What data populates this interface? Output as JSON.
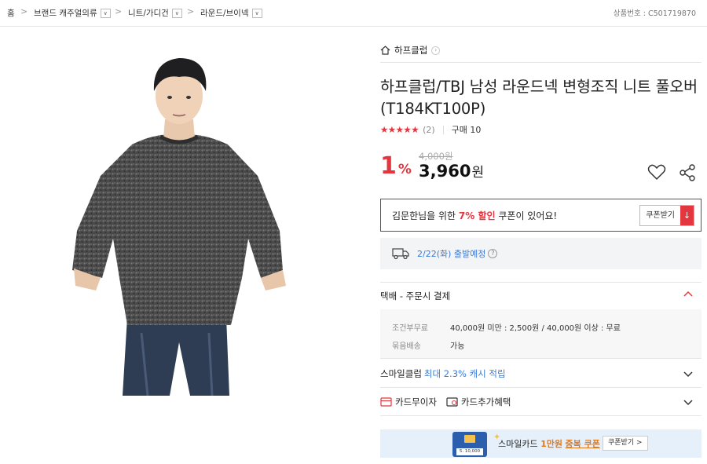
{
  "breadcrumb": {
    "home": "홈",
    "level1": "브랜드 캐주얼의류",
    "level2": "니트/가디건",
    "level3": "라운드/브이넥",
    "separator": ">",
    "dropdown_icon": "chevron-down-icon"
  },
  "product_number_label": "상품번호 : C501719870",
  "store": {
    "name": "하프클럽"
  },
  "product": {
    "title": "하프클럽/TBJ 남성 라운드넥 변형조직 니트 풀오버(T184KT100P)",
    "stars": "★★★★★",
    "review_count": "(2)",
    "purchase_count": "구매 10",
    "original_price": "4,000원",
    "discount_rate": "1",
    "discount_unit": "%",
    "sale_price": "3,960",
    "currency": "원"
  },
  "coupon": {
    "text_before": "김문한님을 위한 ",
    "highlight": "7% 할인",
    "text_after": " 쿠폰이 있어요!",
    "button_label": "쿠폰받기",
    "download_icon": "↓"
  },
  "shipping": {
    "date": "2/22(화) 출발예정",
    "help": "?"
  },
  "delivery": {
    "header": "택배 - 주문시 결제",
    "rows": [
      {
        "key": "조건부무료",
        "value": "40,000원 미만 : 2,500원 / 40,000원 이상 : 무료"
      },
      {
        "key": "묶음배송",
        "value": "가능"
      }
    ]
  },
  "smileclub": {
    "label": "스마일클럽",
    "benefit": "최대 2.3% 캐시 적립"
  },
  "card_benefits": {
    "interest_free": "카드무이자",
    "extra": "카드추가혜택"
  },
  "banner": {
    "prefix": "스마일카드 ",
    "amount": "1만원",
    "middle": " ",
    "suffix": "중복 쿠폰",
    "button_label": "쿠폰받기 >",
    "card_amount": "5. 10,000"
  },
  "colors": {
    "accent_red": "#e3363f",
    "link_blue": "#3a7bd5",
    "banner_bg": "#e6f0fb"
  }
}
